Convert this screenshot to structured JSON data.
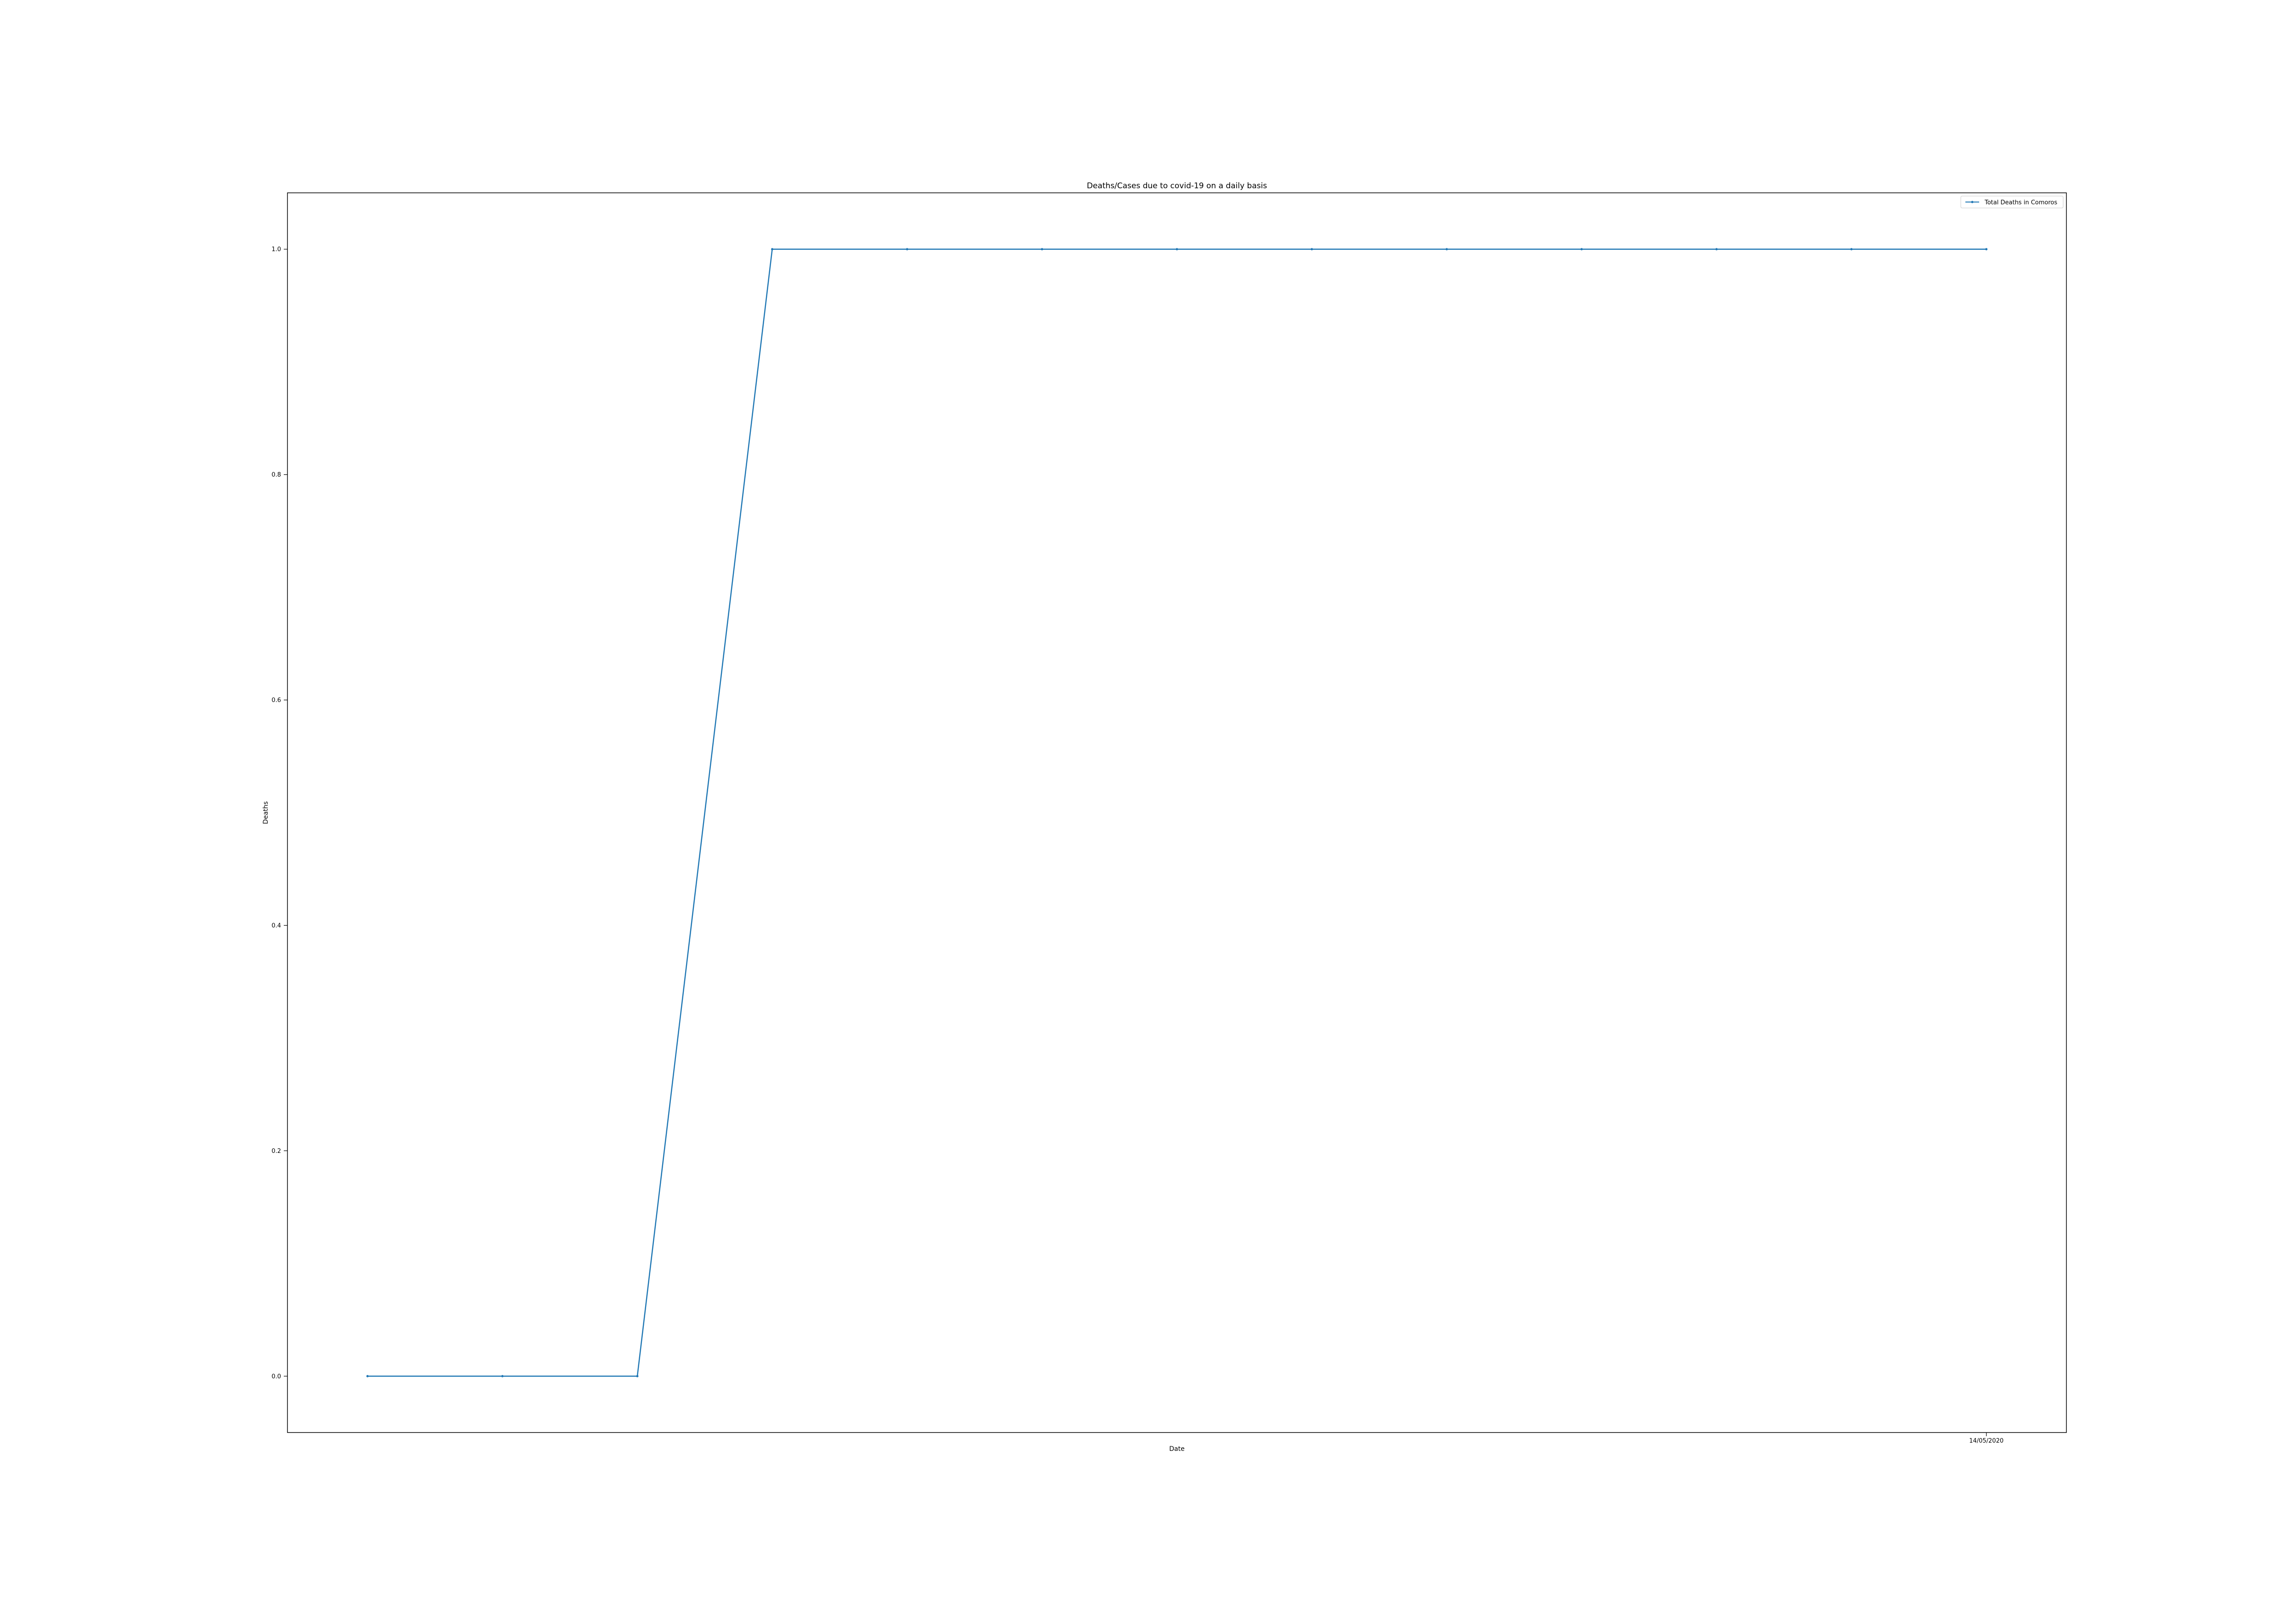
{
  "chart_data": {
    "type": "line",
    "title": "Deaths/Cases due to covid-19 on a daily basis",
    "xlabel": "Date",
    "ylabel": "Deaths",
    "x_tick_labels": [
      "14/05/2020"
    ],
    "x_tick_index": [
      12
    ],
    "y_ticks": [
      0.0,
      0.2,
      0.4,
      0.6,
      0.8,
      1.0
    ],
    "y_tick_labels": [
      "0.0",
      "0.2",
      "0.4",
      "0.6",
      "0.8",
      "1.0"
    ],
    "ylim": [
      -0.05,
      1.05
    ],
    "grid": false,
    "legend_position": "top-right",
    "series": [
      {
        "name": "Total Deaths in Comoros",
        "color": "#1f77b4",
        "marker": "dot",
        "values": [
          0,
          0,
          0,
          1,
          1,
          1,
          1,
          1,
          1,
          1,
          1,
          1,
          1
        ]
      }
    ]
  }
}
